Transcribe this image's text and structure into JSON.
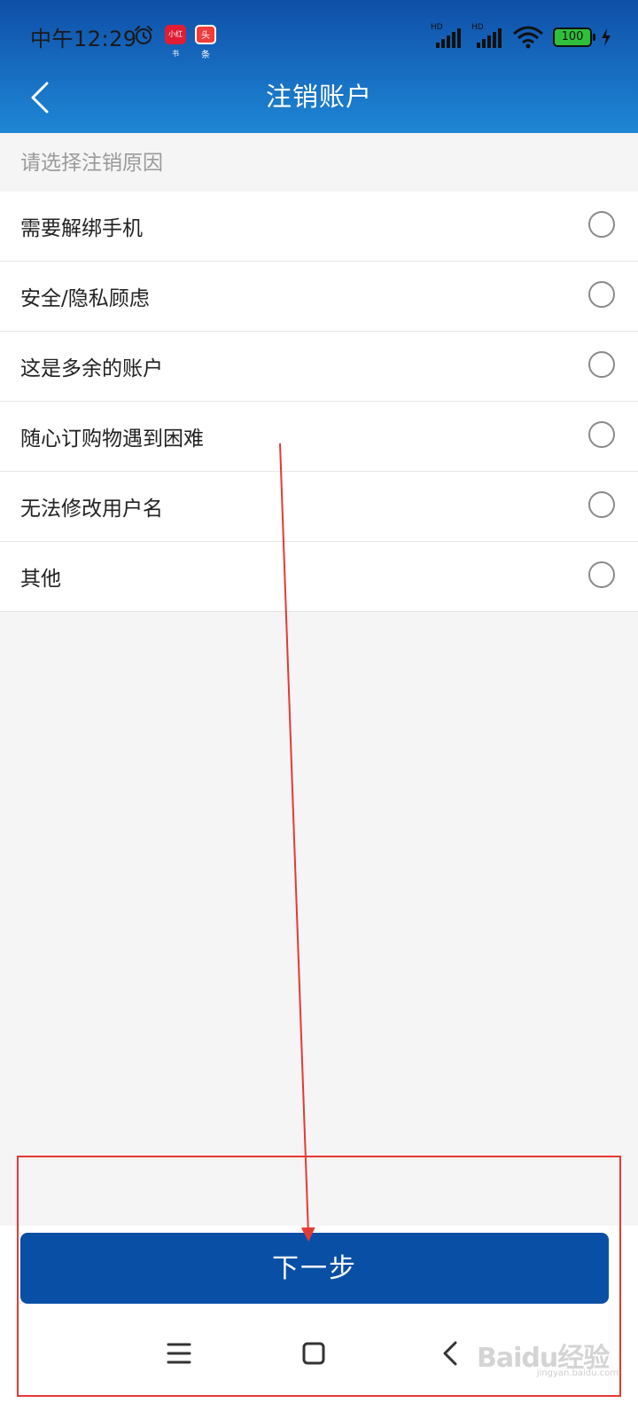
{
  "status_bar": {
    "time": "中午12:29",
    "app_badges": [
      "小红书",
      "头条"
    ],
    "signal_label": "HD",
    "battery_level": "100"
  },
  "header": {
    "title": "注销账户"
  },
  "section": {
    "caption": "请选择注销原因"
  },
  "reasons": [
    {
      "label": "需要解绑手机",
      "selected": false
    },
    {
      "label": "安全/隐私顾虑",
      "selected": false
    },
    {
      "label": "这是多余的账户",
      "selected": false
    },
    {
      "label": "随心订购物遇到困难",
      "selected": false
    },
    {
      "label": "无法修改用户名",
      "selected": false
    },
    {
      "label": "其他",
      "selected": false
    }
  ],
  "footer": {
    "next_label": "下一步"
  },
  "watermark": {
    "text": "Baidu经验",
    "sub": "jingyan.baidu.com"
  },
  "colors": {
    "header_top": "#0f4fa8",
    "header_bottom": "#1f86d4",
    "button_bg": "#0a4fa6",
    "annotation": "#e53935",
    "page_bg": "#f5f5f5"
  }
}
